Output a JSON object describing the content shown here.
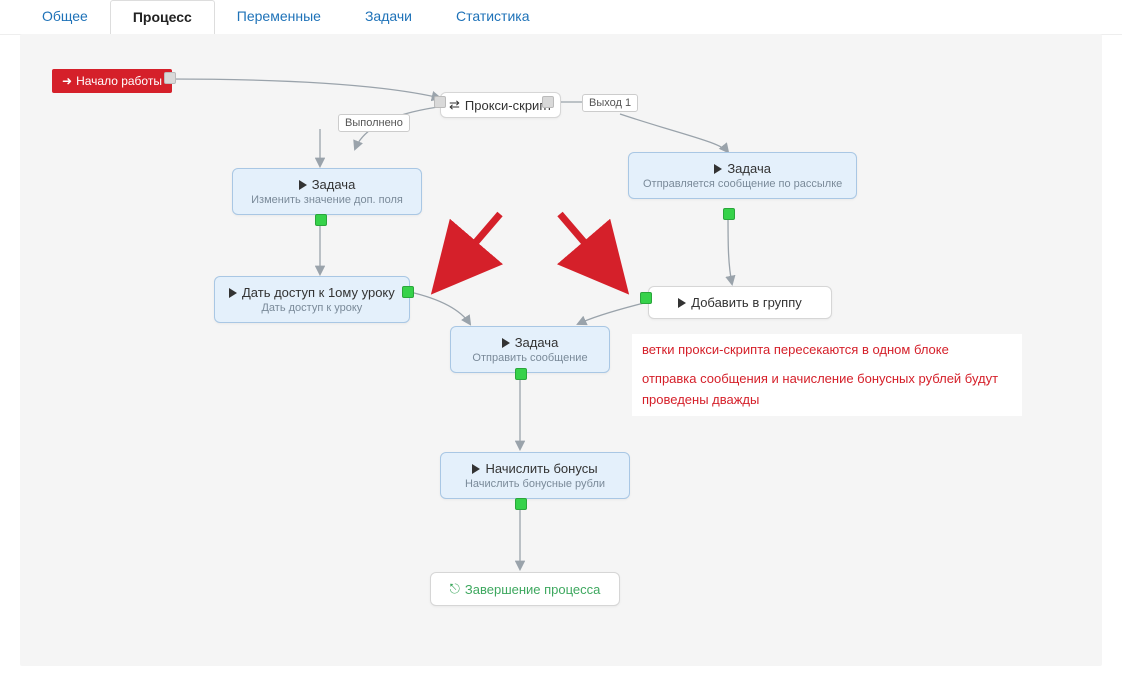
{
  "tabs": [
    {
      "label": "Общее",
      "active": false
    },
    {
      "label": "Процесс",
      "active": true
    },
    {
      "label": "Переменные",
      "active": false
    },
    {
      "label": "Задачи",
      "active": false
    },
    {
      "label": "Статистика",
      "active": false
    }
  ],
  "nodes": {
    "start": {
      "label": "Начало работы"
    },
    "proxy": {
      "title": "Прокси-скрипт",
      "icon": "proxy-icon"
    },
    "task1": {
      "title": "Задача",
      "sub": "Изменить значение доп. поля"
    },
    "task_lesson": {
      "title": "Дать доступ к 1ому уроку",
      "sub": "Дать доступ к уроку"
    },
    "task_msg_list": {
      "title": "Задача",
      "sub": "Отправляется сообщение по рассылке"
    },
    "task_group": {
      "title": "Добавить в группу"
    },
    "task_send": {
      "title": "Задача",
      "sub": "Отправить сообщение"
    },
    "task_bonus": {
      "title": "Начислить бонусы",
      "sub": "Начислить бонусные рубли"
    },
    "end": {
      "title": "Завершение процесса",
      "icon": "exit-icon"
    }
  },
  "edge_labels": {
    "done": "Выполнено",
    "exit1": "Выход 1"
  },
  "annotation": {
    "line1": "ветки прокси-скрипта пересекаются в одном блоке",
    "line2": "отправка сообщения и начисление бонусных рублей  будут проведены дважды"
  },
  "colors": {
    "accent_red": "#d5202a",
    "node_bg": "#e4f0fb",
    "node_border": "#a9c7e4",
    "port_green": "#36d24a",
    "link": "#9aa3ab",
    "tab_link": "#1e72b8",
    "end_green": "#3ea85f"
  }
}
